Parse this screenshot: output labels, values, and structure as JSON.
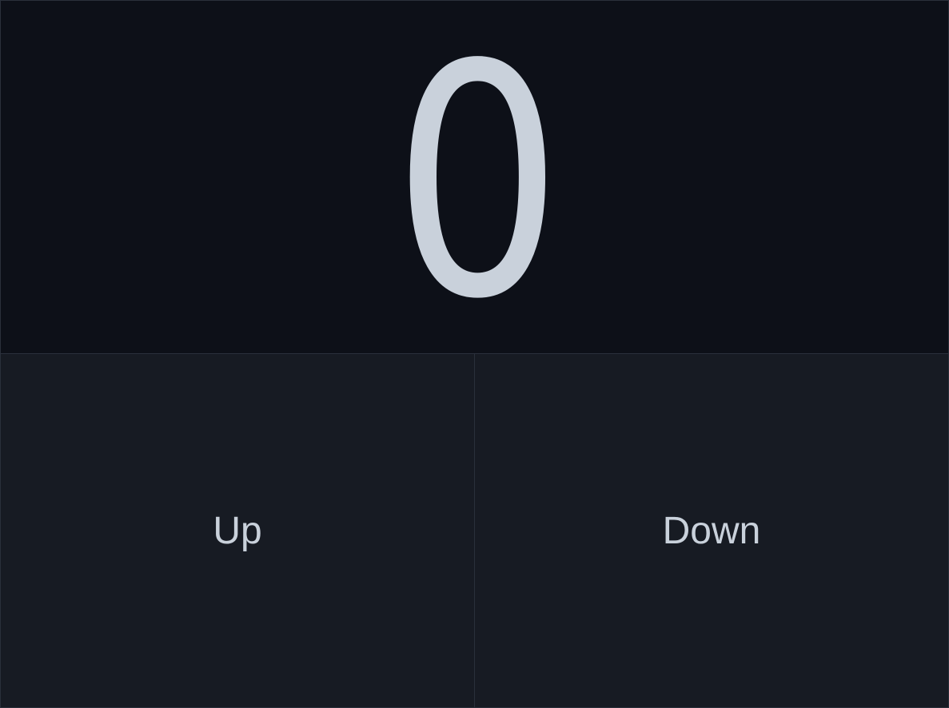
{
  "counter": {
    "value": "0"
  },
  "controls": {
    "up_label": "Up",
    "down_label": "Down"
  },
  "colors": {
    "display_background": "#0d1018",
    "controls_background": "#171b23",
    "text": "#c9d1db",
    "divider": "#2a303b"
  }
}
